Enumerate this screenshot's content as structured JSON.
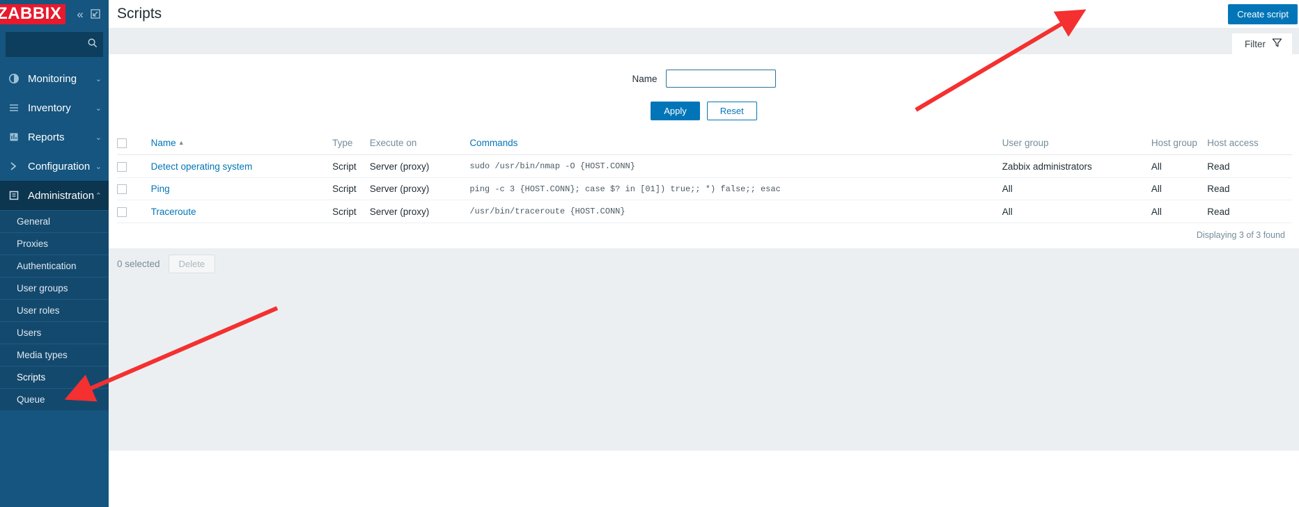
{
  "sidebar": {
    "logo_text": "ZABBIX",
    "collapse_icon": "chevron-double-left-icon",
    "expand_icon": "expand-window-icon",
    "search": {
      "value": "",
      "placeholder": "",
      "icon": "search-icon"
    },
    "menu": [
      {
        "label": "Monitoring",
        "icon": "monitoring-icon",
        "arrow": "⌄"
      },
      {
        "label": "Inventory",
        "icon": "inventory-icon",
        "arrow": "⌄"
      },
      {
        "label": "Reports",
        "icon": "reports-icon",
        "arrow": "⌄"
      },
      {
        "label": "Configuration",
        "icon": "configuration-icon",
        "arrow": "⌄"
      },
      {
        "label": "Administration",
        "icon": "administration-icon",
        "arrow": "⌃"
      }
    ],
    "submenu": [
      {
        "label": "General"
      },
      {
        "label": "Proxies"
      },
      {
        "label": "Authentication"
      },
      {
        "label": "User groups"
      },
      {
        "label": "User roles"
      },
      {
        "label": "Users"
      },
      {
        "label": "Media types"
      },
      {
        "label": "Scripts"
      },
      {
        "label": "Queue"
      }
    ]
  },
  "header": {
    "title": "Scripts",
    "create_button": "Create script"
  },
  "filter": {
    "tab_label": "Filter",
    "tab_icon": "funnel-icon",
    "name_label": "Name",
    "name_value": "",
    "name_placeholder": "",
    "apply_label": "Apply",
    "reset_label": "Reset"
  },
  "table": {
    "columns": {
      "name": "Name",
      "type": "Type",
      "execute_on": "Execute on",
      "commands": "Commands",
      "user_group": "User group",
      "host_group": "Host group",
      "host_access": "Host access"
    },
    "sort_indicator": "▲",
    "rows": [
      {
        "name": "Detect operating system",
        "type": "Script",
        "execute_on": "Server (proxy)",
        "commands": "sudo /usr/bin/nmap -O {HOST.CONN}",
        "user_group": "Zabbix administrators",
        "host_group": "All",
        "host_access": "Read"
      },
      {
        "name": "Ping",
        "type": "Script",
        "execute_on": "Server (proxy)",
        "commands": "ping -c 3 {HOST.CONN}; case $? in [01]) true;; *) false;; esac",
        "user_group": "All",
        "host_group": "All",
        "host_access": "Read"
      },
      {
        "name": "Traceroute",
        "type": "Script",
        "execute_on": "Server (proxy)",
        "commands": "/usr/bin/traceroute {HOST.CONN}",
        "user_group": "All",
        "host_group": "All",
        "host_access": "Read"
      }
    ],
    "displaying": "Displaying 3 of 3 found"
  },
  "footer": {
    "selected_text": "0 selected",
    "delete_label": "Delete"
  },
  "annotations": {
    "arrow_color": "#f43030"
  }
}
